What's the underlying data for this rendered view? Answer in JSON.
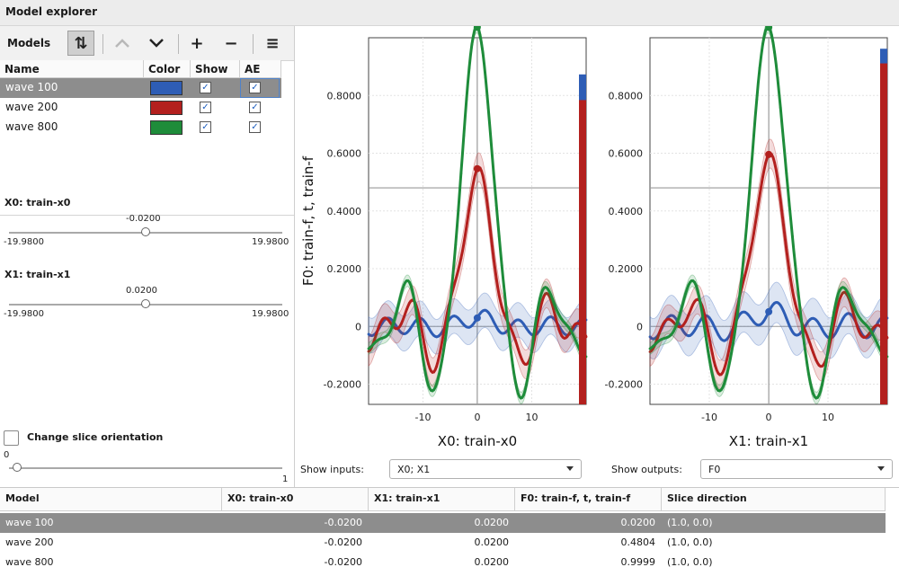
{
  "window": {
    "title": "Model explorer"
  },
  "toolbar": {
    "models_label": "Models",
    "sort_icon": "sort-toggle-icon",
    "buttons": [
      "move-up-icon",
      "move-down-icon",
      "add-icon",
      "remove-icon",
      "menu-icon"
    ]
  },
  "models_table": {
    "headers": [
      "Name",
      "Color",
      "Show",
      "AE"
    ],
    "rows": [
      {
        "name": "wave 100",
        "color": "#2e5db5",
        "show": true,
        "ae": true,
        "selected": true
      },
      {
        "name": "wave 200",
        "color": "#b3201e",
        "show": true,
        "ae": true,
        "selected": false
      },
      {
        "name": "wave 800",
        "color": "#1e8c3a",
        "show": true,
        "ae": true,
        "selected": false
      }
    ]
  },
  "sliders": [
    {
      "title": "X0: train-x0",
      "value": "-0.0200",
      "min": "-19.9800",
      "max": "19.9800",
      "position": 0.4995
    },
    {
      "title": "X1: train-x1",
      "value": "0.0200",
      "min": "-19.9800",
      "max": "19.9800",
      "position": 0.5005
    }
  ],
  "slice": {
    "label": "Change slice orientation",
    "checked": false,
    "min": "0",
    "max": "1",
    "value": 0
  },
  "show_inputs": {
    "label": "Show inputs:",
    "value": "X0; X1"
  },
  "show_outputs": {
    "label": "Show outputs:",
    "value": "F0"
  },
  "chart_data": [
    {
      "type": "line",
      "xlabel": "X0: train-x0",
      "ylabel": "F0: train-f, t, train-f",
      "xticks": [
        "-10",
        "0",
        "10"
      ],
      "yticks": [
        "-0.2000",
        "0",
        "0.2000",
        "0.4000",
        "0.6000",
        "0.8000"
      ],
      "xlim": [
        -20,
        20
      ],
      "ylim": [
        -0.27,
        1.0
      ],
      "crosshair": {
        "x": -0.02,
        "y": 0.48
      },
      "series": [
        {
          "color": "#2e5db5",
          "peak": 0.02,
          "scale": 0.03,
          "wiggle": 0.03,
          "band": 0.06
        },
        {
          "color": "#b3201e",
          "peak": 0.5,
          "scale": 0.5,
          "wiggle": 0.08,
          "band": 0.05
        },
        {
          "color": "#1e8c3a",
          "peak": 1.0,
          "scale": 1.0,
          "wiggle": 0.1,
          "band": 0.02
        }
      ],
      "side_bar": {
        "blue": 0.9,
        "red": 0.83
      }
    },
    {
      "type": "line",
      "xlabel": "X1: train-x1",
      "ylabel": "",
      "xticks": [
        "-10",
        "0",
        "10"
      ],
      "yticks": [
        "-0.2000",
        "0",
        "0.2000",
        "0.4000",
        "0.6000",
        "0.8000"
      ],
      "xlim": [
        -20,
        20
      ],
      "ylim": [
        -0.27,
        1.0
      ],
      "crosshair": {
        "x": 0.02,
        "y": 0.48
      },
      "series": [
        {
          "color": "#2e5db5",
          "peak": 0.1,
          "scale": 0.05,
          "wiggle": 0.04,
          "band": 0.07
        },
        {
          "color": "#b3201e",
          "peak": 0.58,
          "scale": 0.55,
          "wiggle": 0.08,
          "band": 0.05
        },
        {
          "color": "#1e8c3a",
          "peak": 1.0,
          "scale": 1.0,
          "wiggle": 0.1,
          "band": 0.02
        }
      ],
      "side_bar": {
        "blue": 0.97,
        "red": 0.93
      }
    }
  ],
  "results_table": {
    "headers": [
      "Model",
      "X0: train-x0",
      "X1: train-x1",
      "F0: train-f, t, train-f",
      "Slice direction"
    ],
    "rows": [
      {
        "model": "wave 100",
        "x0": "-0.0200",
        "x1": "0.0200",
        "f0": "0.0200",
        "slice": "(1.0, 0.0)",
        "selected": true
      },
      {
        "model": "wave 200",
        "x0": "-0.0200",
        "x1": "0.0200",
        "f0": "0.4804",
        "slice": "(1.0, 0.0)",
        "selected": false
      },
      {
        "model": "wave 800",
        "x0": "-0.0200",
        "x1": "0.0200",
        "f0": "0.9999",
        "slice": "(1.0, 0.0)",
        "selected": false
      }
    ]
  }
}
